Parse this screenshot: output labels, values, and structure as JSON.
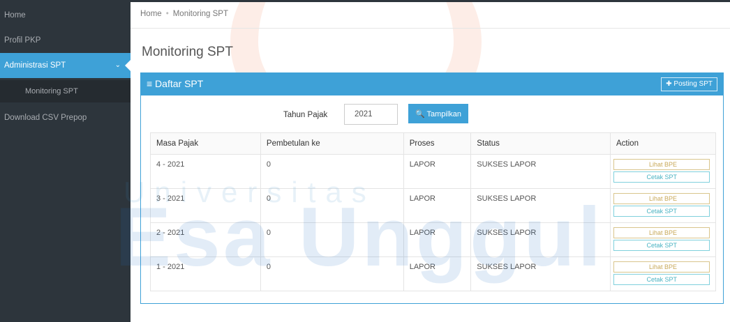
{
  "sidebar": {
    "items": [
      {
        "label": "Home"
      },
      {
        "label": "Profil PKP"
      },
      {
        "label": "Administrasi SPT"
      },
      {
        "label": "Download CSV Prepop"
      }
    ],
    "sub_items": [
      {
        "label": "Monitoring SPT"
      }
    ]
  },
  "breadcrumb": {
    "home": "Home",
    "sep": "•",
    "current": "Monitoring SPT"
  },
  "page": {
    "title": "Monitoring SPT"
  },
  "panel": {
    "title": "≡ Daftar SPT",
    "posting_label": "✚ Posting SPT"
  },
  "filter": {
    "label": "Tahun Pajak",
    "value": "2021",
    "button_label": "🔍 Tampilkan"
  },
  "table": {
    "headers": [
      "Masa Pajak",
      "Pembetulan ke",
      "Proses",
      "Status",
      "Action"
    ],
    "rows": [
      {
        "masa": "4 - 2021",
        "pembetulan": "0",
        "proses": "LAPOR",
        "status": "SUKSES LAPOR"
      },
      {
        "masa": "3 - 2021",
        "pembetulan": "0",
        "proses": "LAPOR",
        "status": "SUKSES LAPOR"
      },
      {
        "masa": "2 - 2021",
        "pembetulan": "0",
        "proses": "LAPOR",
        "status": "SUKSES LAPOR"
      },
      {
        "masa": "1 - 2021",
        "pembetulan": "0",
        "proses": "LAPOR",
        "status": "SUKSES LAPOR"
      }
    ],
    "action_lihat": "Lihat BPE",
    "action_cetak": "Cetak SPT"
  },
  "watermark": {
    "line1": "Universitas",
    "line2": "Esa Unggul"
  },
  "colors": {
    "accent": "#3ea1d7",
    "sidebar_bg": "#2d353c"
  }
}
